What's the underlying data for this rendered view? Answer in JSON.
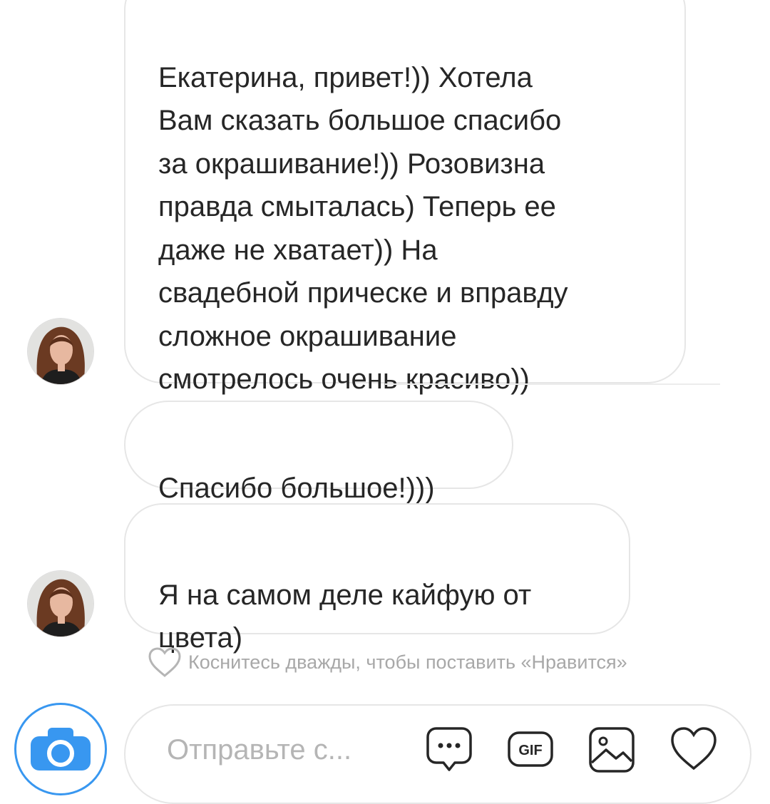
{
  "messages": [
    {
      "text": "Екатерина, привет!)) Хотела\nВам сказать большое спасибо\nза окрашивание!)) Розовизна\nправда смыталась) Теперь ее\nдаже не хватает)) На\nсвадебной прическе и вправду\nсложное окрашивание\nсмотрелось очень красиво))"
    },
    {
      "text": "Спасибо большое!)))"
    },
    {
      "text": "Я на самом деле кайфую от\nцвета)"
    }
  ],
  "like_hint": "Коснитесь дважды, чтобы поставить «Нравится»",
  "composer": {
    "placeholder": "Отправьте с...",
    "icons": [
      "camera-icon",
      "sticker-icon",
      "gif-icon",
      "photo-icon",
      "heart-icon"
    ]
  },
  "colors": {
    "accent": "#3897f0",
    "bubble_border": "#e6e6e6",
    "text": "#262626",
    "hint": "#a8a8a8"
  }
}
